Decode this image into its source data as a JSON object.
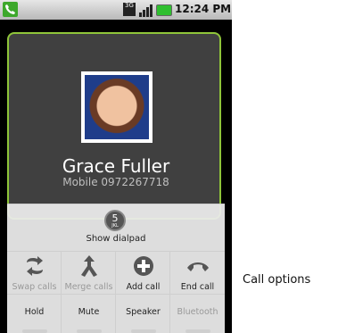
{
  "status_bar": {
    "network_badge": "3G",
    "time": "12:24 PM",
    "icons": [
      "phone-call-icon",
      "3g-icon",
      "signal-icon",
      "battery-icon"
    ]
  },
  "contact": {
    "name": "Grace Fuller",
    "number": "Mobile 0972267718",
    "photo": "contact-photo"
  },
  "dialpad": {
    "key_number": "5",
    "key_letters": "JKL",
    "label": "Show dialpad"
  },
  "call_options": {
    "row1": [
      {
        "label": "Swap calls",
        "icon": "swap-calls-icon",
        "enabled": false
      },
      {
        "label": "Merge calls",
        "icon": "merge-calls-icon",
        "enabled": false
      },
      {
        "label": "Add call",
        "icon": "add-call-icon",
        "enabled": true
      },
      {
        "label": "End call",
        "icon": "end-call-icon",
        "enabled": true
      }
    ],
    "row2": [
      {
        "label": "Hold",
        "enabled": true
      },
      {
        "label": "Mute",
        "enabled": true
      },
      {
        "label": "Speaker",
        "enabled": true
      },
      {
        "label": "Bluetooth",
        "enabled": false
      }
    ]
  },
  "callout": "Call options",
  "colors": {
    "accent": "#8fc53a",
    "call_card": "#404040",
    "panel": "#ebebeb"
  }
}
